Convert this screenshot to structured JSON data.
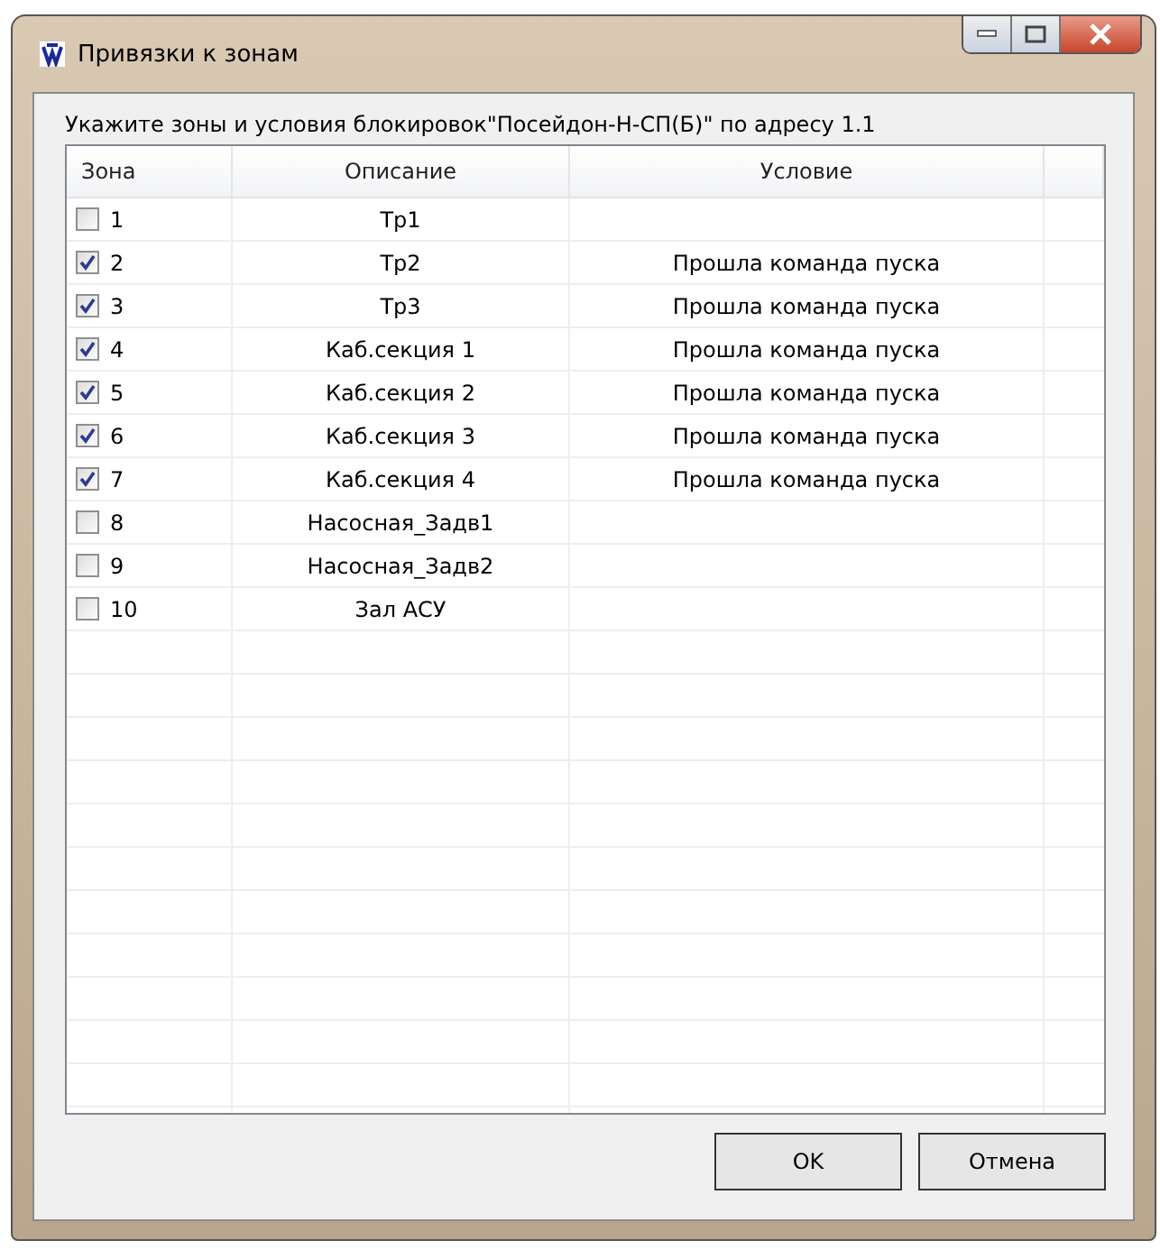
{
  "window": {
    "title": "Привязки к зонам"
  },
  "prompt": "Укажите зоны и условия блокировок\"Посейдон-Н-СП(Б)\" по адресу 1.1",
  "table": {
    "columns": [
      "Зона",
      "Описание",
      "Условие"
    ],
    "rows": [
      {
        "zone": "1",
        "checked": false,
        "description": "Тр1",
        "condition": ""
      },
      {
        "zone": "2",
        "checked": true,
        "description": "Тр2",
        "condition": "Прошла команда пуска"
      },
      {
        "zone": "3",
        "checked": true,
        "description": "Тр3",
        "condition": "Прошла команда пуска"
      },
      {
        "zone": "4",
        "checked": true,
        "description": "Каб.секция 1",
        "condition": "Прошла команда пуска"
      },
      {
        "zone": "5",
        "checked": true,
        "description": "Каб.секция 2",
        "condition": "Прошла команда пуска"
      },
      {
        "zone": "6",
        "checked": true,
        "description": "Каб.секция 3",
        "condition": "Прошла команда пуска"
      },
      {
        "zone": "7",
        "checked": true,
        "description": "Каб.секция 4",
        "condition": "Прошла команда пуска"
      },
      {
        "zone": "8",
        "checked": false,
        "description": "Насосная_Задв1",
        "condition": ""
      },
      {
        "zone": "9",
        "checked": false,
        "description": "Насосная_Задв2",
        "condition": ""
      },
      {
        "zone": "10",
        "checked": false,
        "description": "Зал АСУ",
        "condition": ""
      }
    ]
  },
  "buttons": [
    "OK",
    "Отмена"
  ]
}
